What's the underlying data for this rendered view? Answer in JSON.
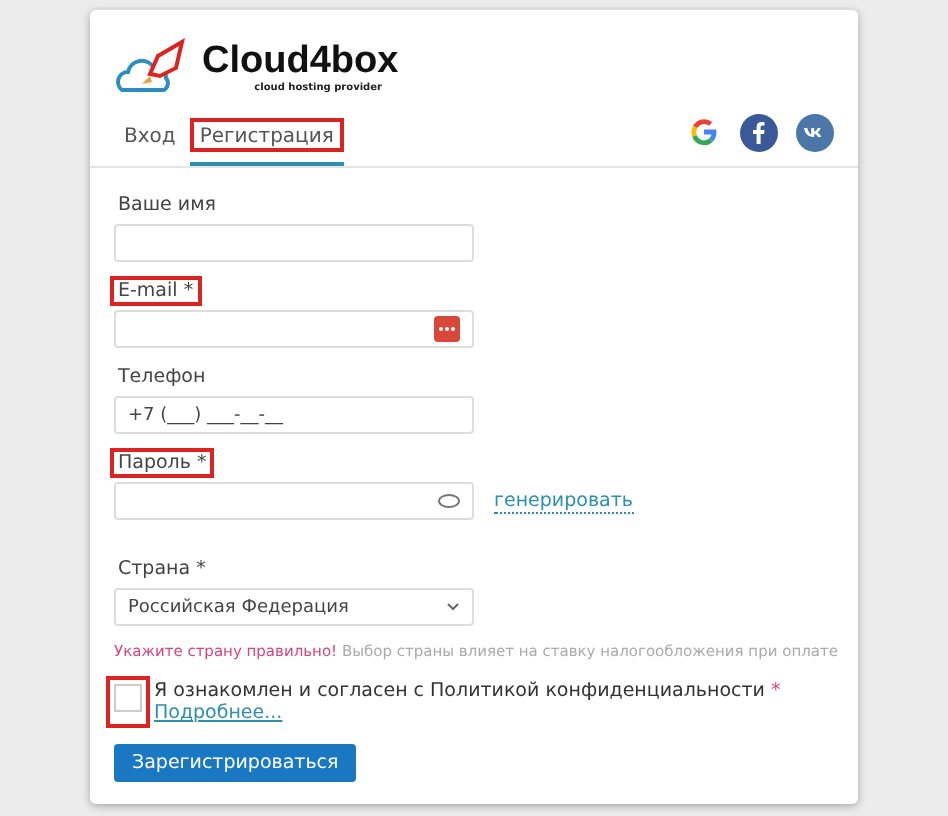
{
  "logo": {
    "name": "Cloud4box",
    "tagline": "cloud hosting provider"
  },
  "tabs": [
    {
      "label": "Вход",
      "selected": false,
      "highlighted": false
    },
    {
      "label": "Регистрация",
      "selected": true,
      "highlighted": true
    }
  ],
  "social": [
    {
      "kind": "google"
    },
    {
      "kind": "facebook"
    },
    {
      "kind": "vk"
    }
  ],
  "fields": [
    {
      "kind": "text",
      "label": "Ваше имя",
      "highlighted": false
    },
    {
      "kind": "email",
      "label": "E-mail",
      "required_mark": "*",
      "highlighted": true
    },
    {
      "kind": "phone",
      "label": "Телефон",
      "value": "+7 (___) ___-__-__",
      "highlighted": false
    },
    {
      "kind": "password",
      "label": "Пароль",
      "required_mark": "*",
      "highlighted": true,
      "action_link": "генерировать"
    },
    {
      "kind": "select",
      "label": "Страна",
      "required_mark": "*",
      "highlighted": false,
      "value": "Российская Федерация"
    }
  ],
  "hint": {
    "warning": "Укажите страну правильно!",
    "text": "Выбор страны влияет на ставку налогообложения при оплате"
  },
  "consent": {
    "checked": false,
    "highlighted": true,
    "text": "Я ознакомлен и согласен с Политикой конфиденциальности",
    "required_mark": "*",
    "link": "Подробнее..."
  },
  "submit": "Зарегистрироваться"
}
